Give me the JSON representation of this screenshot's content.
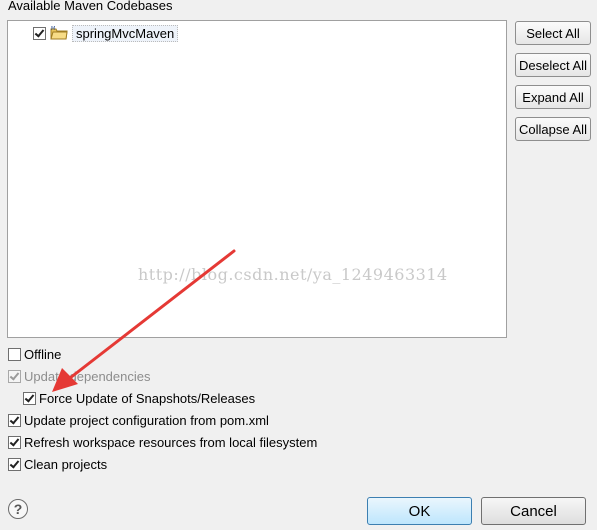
{
  "codebases": {
    "title": "Available Maven Codebases",
    "items": [
      {
        "label": "springMvcMaven",
        "checked": true,
        "icon": "maven-project-folder-icon"
      }
    ]
  },
  "side_buttons": {
    "select_all": "Select All",
    "deselect_all": "Deselect All",
    "expand_all": "Expand All",
    "collapse_all": "Collapse All"
  },
  "options": {
    "offline": {
      "label": "Offline",
      "checked": false,
      "enabled": true
    },
    "update_dependencies": {
      "label": "Update dependencies",
      "checked": true,
      "enabled": false
    },
    "force_update": {
      "label": "Force Update of Snapshots/Releases",
      "checked": true,
      "enabled": true
    },
    "update_config": {
      "label": "Update project configuration from pom.xml",
      "checked": true,
      "enabled": true
    },
    "refresh_workspace": {
      "label": "Refresh workspace resources from local filesystem",
      "checked": true,
      "enabled": true
    },
    "clean_projects": {
      "label": "Clean projects",
      "checked": true,
      "enabled": true
    }
  },
  "footer": {
    "help_icon": "help-question-icon",
    "help_glyph": "?",
    "ok": "OK",
    "cancel": "Cancel"
  },
  "watermark": "http://blog.csdn.net/ya_1249463314",
  "annotation_arrow_color": "#e53935"
}
